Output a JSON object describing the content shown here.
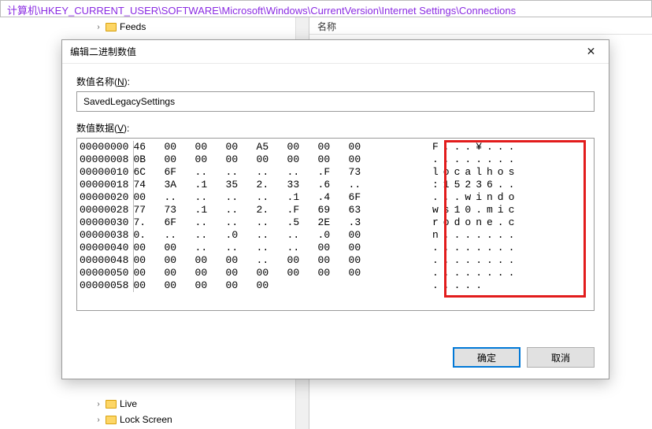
{
  "address_bar": "计算机\\HKEY_CURRENT_USER\\SOFTWARE\\Microsoft\\Windows\\CurrentVersion\\Internet Settings\\Connections",
  "tree": {
    "top_items": [
      "Feeds"
    ],
    "bottom_items": [
      "Live",
      "Lock Screen"
    ]
  },
  "right_header": "名称",
  "dialog": {
    "title": "编辑二进制数值",
    "name_label_prefix": "数值名称(",
    "name_label_key": "N",
    "name_label_suffix": "):",
    "name_value": "SavedLegacySettings",
    "data_label_prefix": "数值数据(",
    "data_label_key": "V",
    "data_label_suffix": "):",
    "ok": "确定",
    "cancel": "取消",
    "rows": [
      {
        "off": "00000000",
        "hex": "46   00   00   00   A5   00   00   00",
        "asc": "F...¥..."
      },
      {
        "off": "00000008",
        "hex": "0B   00   00   00   00   00   00   00",
        "asc": "........"
      },
      {
        "off": "00000010",
        "hex": "6C   6F   ..   ..   ..   ..   .F   73",
        "asc": "localhos"
      },
      {
        "off": "00000018",
        "hex": "74   3A   .1   35   2.   33   .6   ..",
        "asc": ":15236.."
      },
      {
        "off": "00000020",
        "hex": "00   ..   ..   ..   ..   .1   .4   6F",
        "asc": "...windo"
      },
      {
        "off": "00000028",
        "hex": "77   73   .1   ..   2.   .F   69   63",
        "asc": "ws10.mic"
      },
      {
        "off": "00000030",
        "hex": "7.   6F   ..   ..   ..   .5   2E   .3",
        "asc": "rodone.c"
      },
      {
        "off": "00000038",
        "hex": "0.   ..   ..   .0   ..   ..   .0   00",
        "asc": "n......."
      },
      {
        "off": "00000040",
        "hex": "00   00   ..   ..   ..   ..   00   00",
        "asc": "........"
      },
      {
        "off": "00000048",
        "hex": "00   00   00   00   ..   00   00   00",
        "asc": "........"
      },
      {
        "off": "00000050",
        "hex": "00   00   00   00   00   00   00   00",
        "asc": "........"
      },
      {
        "off": "00000058",
        "hex": "00   00   00   00   00",
        "asc": "....."
      }
    ]
  }
}
